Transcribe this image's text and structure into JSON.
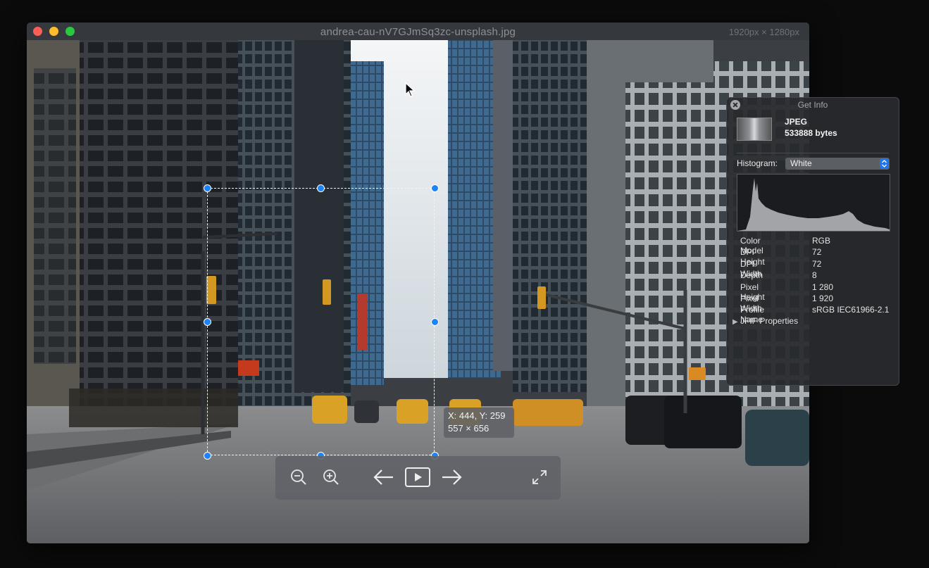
{
  "window": {
    "title": "andrea-cau-nV7GJmSq3zc-unsplash.jpg",
    "dimensions": "1920px × 1280px"
  },
  "selection": {
    "position": "X: 444, Y: 259",
    "size": "557 × 656"
  },
  "toolbar": {
    "icons": [
      "zoom-out-icon",
      "zoom-in-icon",
      "arrow-left-icon",
      "play-icon",
      "arrow-right-icon",
      "fullscreen-icon"
    ]
  },
  "info_panel": {
    "title": "Get Info",
    "format": "JPEG",
    "bytes": "533888 bytes",
    "histogram_label": "Histogram:",
    "histogram_mode": "White",
    "properties": [
      {
        "key": "Color Model",
        "value": "RGB"
      },
      {
        "key": "DPI Height",
        "value": "72"
      },
      {
        "key": "DPI Width",
        "value": "72"
      },
      {
        "key": "Depth",
        "value": "8"
      },
      {
        "key": "Pixel Height",
        "value": "1 280"
      },
      {
        "key": "Pixel Width",
        "value": "1 920"
      },
      {
        "key": "Profile Name",
        "value": "sRGB IEC61966-2.1"
      }
    ],
    "jfif_label": "JFIF Properties"
  },
  "colors": {
    "accent": "#1e83f7",
    "close": "#fc5f57",
    "minimize": "#fdbc2e",
    "maximize": "#28c840"
  }
}
